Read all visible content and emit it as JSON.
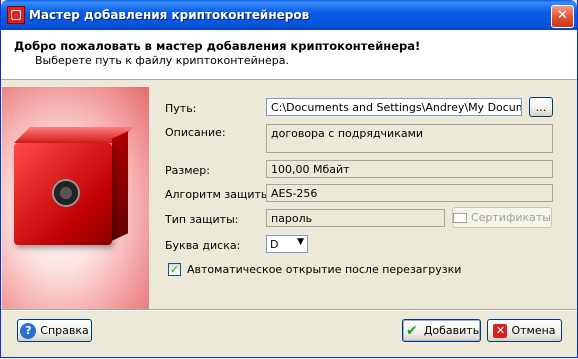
{
  "window": {
    "title": "Мастер добавления криптоконтейнеров",
    "close_label": "✕"
  },
  "header": {
    "title": "Добро пожаловать в мастер добавления криптоконтейнера!",
    "subtitle": "Выберете путь к файлу криптоконтейнера."
  },
  "form": {
    "path_label": "Путь:",
    "path_value": "C:\\Documents and Settings\\Andrey\\My Documents\\",
    "browse_label": "...",
    "description_label": "Описание:",
    "description_value": "договора с подрядчиками",
    "size_label": "Размер:",
    "size_value": "100,00 Мбайт",
    "algorithm_label": "Алгоритм защиты:",
    "algorithm_value": "AES-256",
    "protection_label": "Тип защиты:",
    "protection_value": "пароль",
    "certificates_label": "Сертификаты",
    "drive_label": "Буква диска:",
    "drive_value": "D",
    "autoopen_label": "Автоматическое открытие после перезагрузки",
    "autoopen_checked": true
  },
  "buttons": {
    "help_label": "Справка",
    "add_label": "Добавить",
    "cancel_label": "Отмена"
  },
  "icons": {
    "help": "help-icon",
    "add": "checkmark-icon",
    "cancel": "cancel-icon",
    "certificate": "certificate-icon",
    "app": "safe-icon"
  }
}
